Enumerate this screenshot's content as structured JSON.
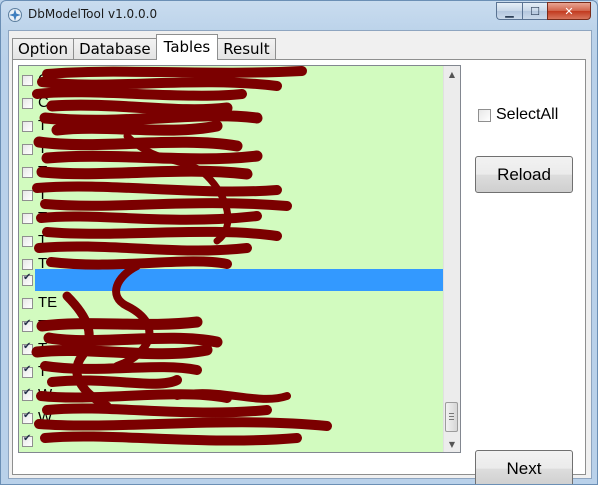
{
  "window": {
    "title": "DbModelTool v1.0.0.0",
    "controls": {
      "minimize": "▁",
      "maximize": "☐",
      "close": "✕"
    }
  },
  "tabs": [
    {
      "label": "Option",
      "active": false
    },
    {
      "label": "Database",
      "active": false
    },
    {
      "label": "Tables",
      "active": true
    },
    {
      "label": "Result",
      "active": false
    }
  ],
  "table_list": {
    "items": [
      {
        "label": "C",
        "checked": false,
        "selected": false
      },
      {
        "label": "C",
        "checked": false,
        "selected": false
      },
      {
        "label": "T",
        "checked": false,
        "selected": false
      },
      {
        "label": "T",
        "checked": false,
        "selected": false
      },
      {
        "label": "T",
        "checked": false,
        "selected": false
      },
      {
        "label": "T",
        "checked": false,
        "selected": false
      },
      {
        "label": "T",
        "checked": false,
        "selected": false
      },
      {
        "label": "T",
        "checked": false,
        "selected": false
      },
      {
        "label": "T",
        "checked": false,
        "selected": false
      },
      {
        "label": "",
        "checked": true,
        "selected": true
      },
      {
        "label": "TE",
        "checked": false,
        "selected": false
      },
      {
        "label": "T",
        "checked": true,
        "selected": false
      },
      {
        "label": "T",
        "checked": true,
        "selected": false
      },
      {
        "label": "T",
        "checked": true,
        "selected": false
      },
      {
        "label": "W",
        "checked": true,
        "selected": false
      },
      {
        "label": "W",
        "checked": true,
        "selected": false
      },
      {
        "label": "",
        "checked": true,
        "selected": false
      }
    ]
  },
  "options": {
    "select_all_label": "SelectAll",
    "select_all_checked": false
  },
  "buttons": {
    "reload": "Reload",
    "next": "Next"
  },
  "colors": {
    "list_background": "#d2fbbf",
    "selection": "#3399ff",
    "redaction": "#7b0000"
  }
}
